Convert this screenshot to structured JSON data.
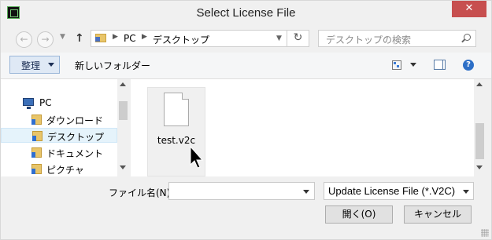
{
  "window": {
    "title": "Select License File",
    "close_label": "✕"
  },
  "address": {
    "segments": [
      "PC",
      "デスクトップ"
    ]
  },
  "search": {
    "placeholder": "デスクトップの検索"
  },
  "toolbar": {
    "organize_label": "整理",
    "new_folder_label": "新しいフォルダー"
  },
  "navpane": {
    "items": [
      {
        "label": "PC",
        "icon": "pc-icon"
      },
      {
        "label": "ダウンロード",
        "icon": "downloads-folder-icon"
      },
      {
        "label": "デスクトップ",
        "icon": "desktop-folder-icon",
        "selected": true
      },
      {
        "label": "ドキュメント",
        "icon": "documents-folder-icon"
      },
      {
        "label": "ピクチャ",
        "icon": "pictures-folder-icon"
      }
    ]
  },
  "files": [
    {
      "name": "test.v2c",
      "icon": "file-icon"
    }
  ],
  "bottom": {
    "filename_label": "ファイル名(N):",
    "filename_value": "",
    "filter_value": "Update License File (*.V2C)",
    "open_label": "開く(O)",
    "cancel_label": "キャンセル"
  }
}
